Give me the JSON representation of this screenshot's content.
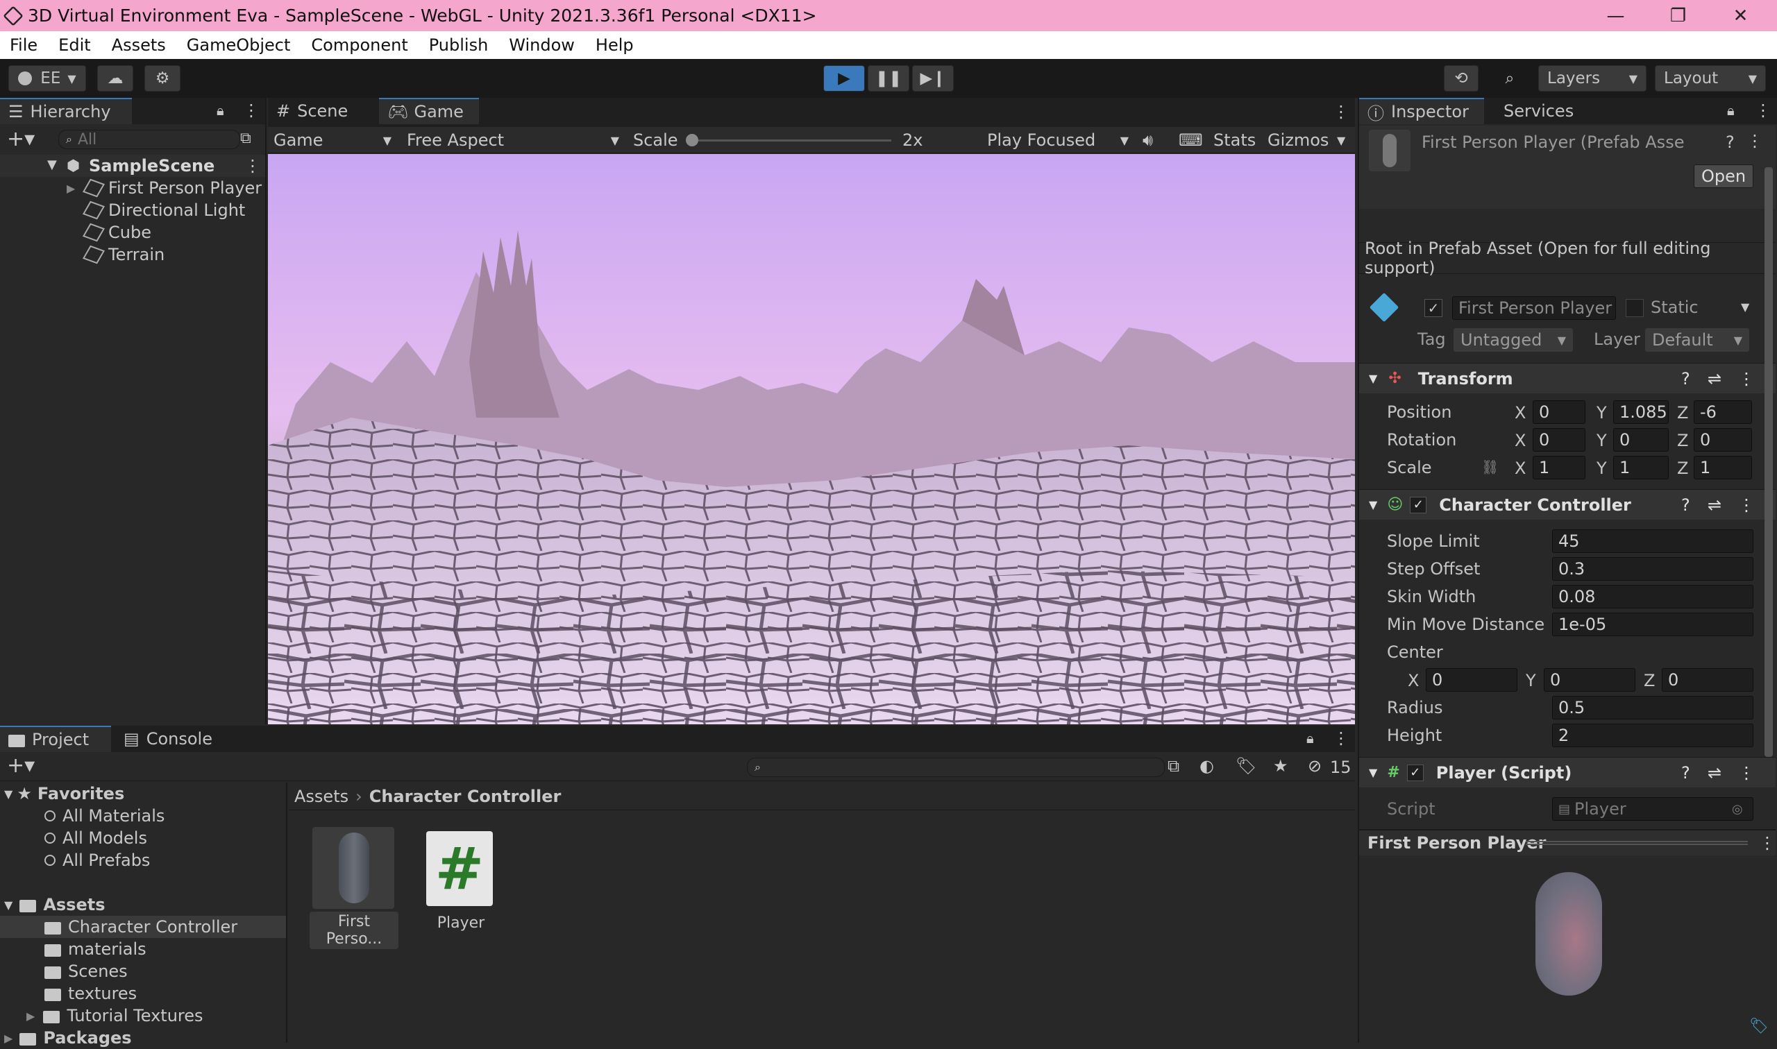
{
  "window": {
    "title": "3D Virtual Environment Eva - SampleScene - WebGL - Unity 2021.3.36f1 Personal <DX11>",
    "minimize": "—",
    "maximize": "❐",
    "close": "✕"
  },
  "menu": [
    "File",
    "Edit",
    "Assets",
    "GameObject",
    "Component",
    "Publish",
    "Window",
    "Help"
  ],
  "toolbar": {
    "account": "EE",
    "layers": "Layers",
    "layout": "Layout"
  },
  "hierarchy": {
    "tab": "Hierarchy",
    "search_placeholder": "All",
    "scene": "SampleScene",
    "items": [
      "First Person Player",
      "Directional Light",
      "Cube",
      "Terrain"
    ]
  },
  "game": {
    "tabs": [
      "Scene",
      "Game"
    ],
    "display": "Game",
    "aspect": "Free Aspect",
    "scale_label": "Scale",
    "scale_value": "2x",
    "play_mode": "Play Focused",
    "stats": "Stats",
    "gizmos": "Gizmos"
  },
  "inspector": {
    "tabs": [
      "Inspector",
      "Services"
    ],
    "asset_title": "First Person Player (Prefab Asse",
    "open_button": "Open",
    "notice": "Root in Prefab Asset (Open for full editing support)",
    "name": "First Person Player",
    "static_label": "Static",
    "tag_label": "Tag",
    "tag_value": "Untagged",
    "layer_label": "Layer",
    "layer_value": "Default",
    "transform": {
      "title": "Transform",
      "rows": [
        {
          "label": "Position",
          "x": "0",
          "y": "1.085",
          "z": "-6"
        },
        {
          "label": "Rotation",
          "x": "0",
          "y": "0",
          "z": "0"
        },
        {
          "label": "Scale",
          "x": "1",
          "y": "1",
          "z": "1"
        }
      ]
    },
    "character_controller": {
      "title": "Character Controller",
      "fields": [
        {
          "label": "Slope Limit",
          "value": "45"
        },
        {
          "label": "Step Offset",
          "value": "0.3"
        },
        {
          "label": "Skin Width",
          "value": "0.08"
        },
        {
          "label": "Min Move Distance",
          "value": "1e-05"
        }
      ],
      "center_label": "Center",
      "center": {
        "x": "0",
        "y": "0",
        "z": "0"
      },
      "radius_label": "Radius",
      "radius": "0.5",
      "height_label": "Height",
      "height": "2"
    },
    "player_script": {
      "title": "Player (Script)",
      "script_label": "Script",
      "script_value": "Player"
    },
    "preview_title": "First Person Player"
  },
  "project": {
    "tabs": [
      "Project",
      "Console"
    ],
    "hidden_count": "15",
    "favorites": "Favorites",
    "favorite_items": [
      "All Materials",
      "All Models",
      "All Prefabs"
    ],
    "assets": "Assets",
    "asset_folders": [
      "Character Controller",
      "materials",
      "Scenes",
      "textures",
      "Tutorial Textures"
    ],
    "packages": "Packages",
    "breadcrumb": [
      "Assets",
      "Character Controller"
    ],
    "files": [
      {
        "name": "First Perso...",
        "icon": "capsule-prefab-icon"
      },
      {
        "name": "Player",
        "icon": "csharp-script-icon"
      }
    ]
  },
  "xyz_labels": {
    "x": "X",
    "y": "Y",
    "z": "Z"
  }
}
